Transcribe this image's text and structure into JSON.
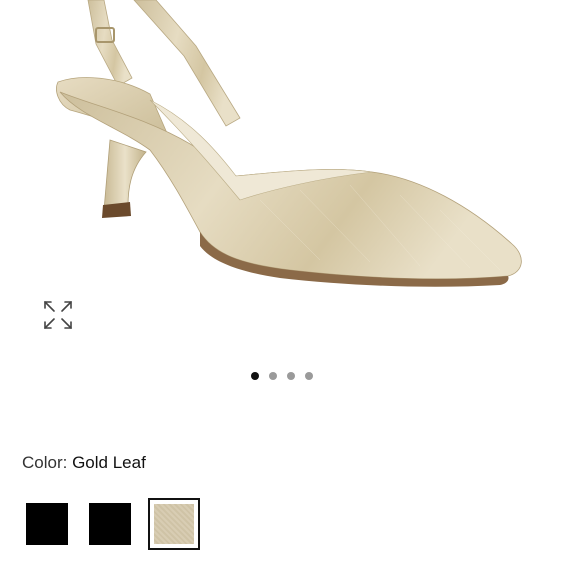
{
  "product": {
    "name": "Gold Leaf slingback kitten-heel pump",
    "accent_color": "#d6c9a8"
  },
  "gallery": {
    "expand_icon": "expand-arrows-icon",
    "slide_count": 4,
    "active_slide": 1
  },
  "color_selector": {
    "label": "Color:",
    "selected": "Gold Leaf",
    "swatches": [
      {
        "color": "#000000",
        "selected": false
      },
      {
        "color": "#000000",
        "selected": false
      },
      {
        "color": "#d6c9a8",
        "selected": true
      }
    ]
  }
}
